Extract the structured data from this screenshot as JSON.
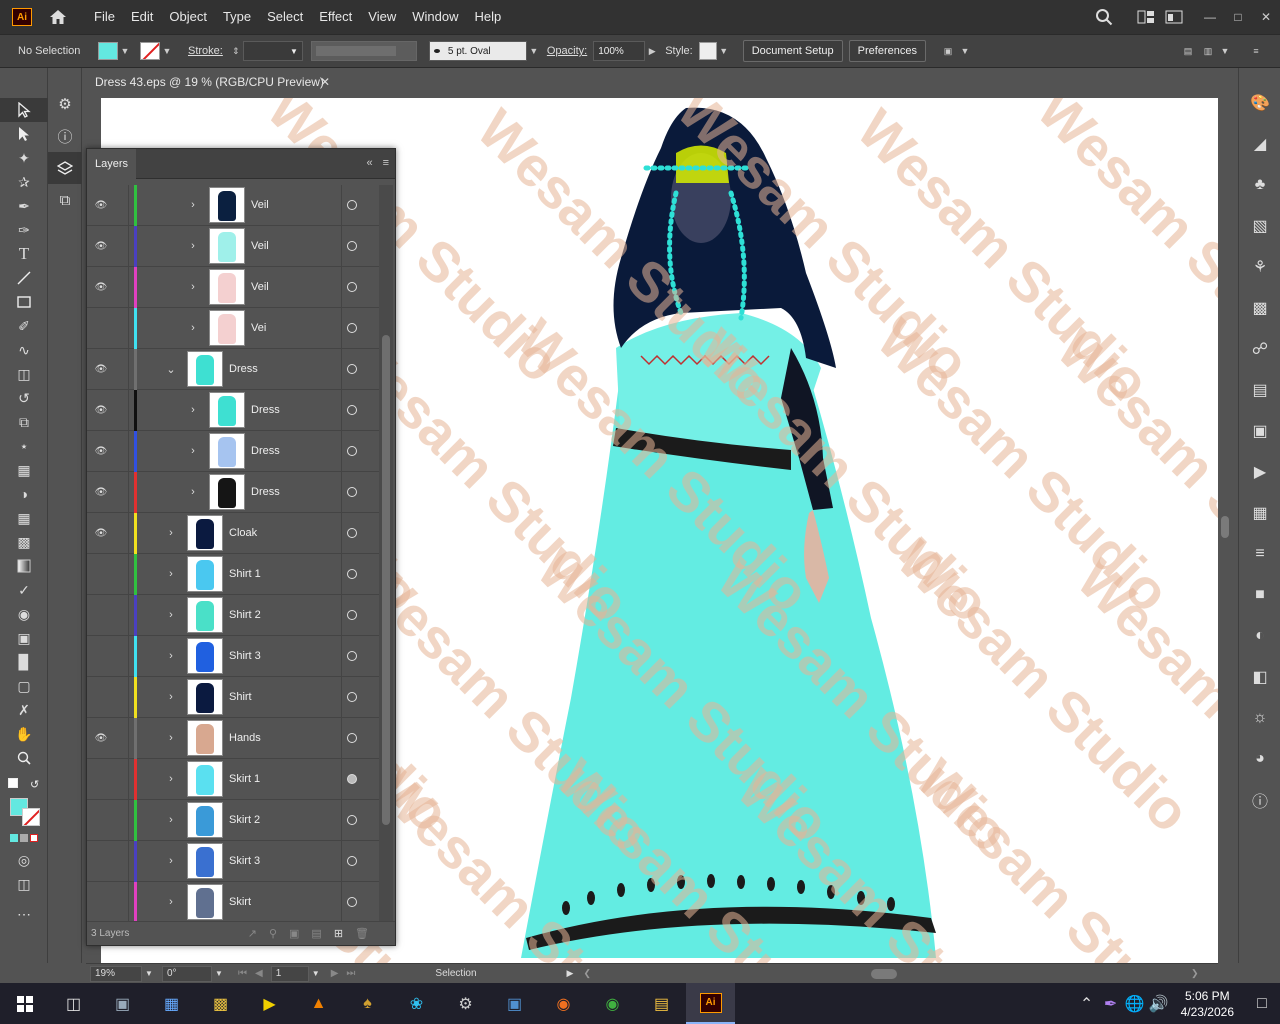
{
  "app": {
    "logo": "Ai",
    "menu": [
      "File",
      "Edit",
      "Object",
      "Type",
      "Select",
      "Effect",
      "View",
      "Window",
      "Help"
    ]
  },
  "control": {
    "selection": "No Selection",
    "stroke_label": "Stroke:",
    "brush": "5 pt. Oval",
    "opacity_label": "Opacity:",
    "opacity_value": "100%",
    "style_label": "Style:",
    "document_setup": "Document Setup",
    "preferences": "Preferences"
  },
  "document": {
    "tab_title": "Dress 43.eps @ 19 % (RGB/CPU Preview)",
    "watermark": "Wesam Studio"
  },
  "layers_panel": {
    "title": "Layers",
    "count": "3 Layers",
    "rows": [
      {
        "name": "Veil",
        "visible": true,
        "color": "#30c040",
        "indent": 2,
        "expanded": false,
        "thumb": "#0b2040",
        "target_filled": false
      },
      {
        "name": "Veil",
        "visible": true,
        "color": "#4a40c0",
        "indent": 2,
        "expanded": false,
        "thumb": "#9ff0ea",
        "target_filled": false
      },
      {
        "name": "Veil",
        "visible": true,
        "color": "#e040c0",
        "indent": 2,
        "expanded": false,
        "thumb": "#f4d0d0",
        "target_filled": false
      },
      {
        "name": "Vei",
        "visible": false,
        "color": "#40e0f0",
        "indent": 2,
        "expanded": false,
        "thumb": "#f4d0d0",
        "target_filled": false
      },
      {
        "name": "Dress",
        "visible": true,
        "color": "#707070",
        "indent": 1,
        "expanded": true,
        "thumb": "#3ee0d2",
        "target_filled": false
      },
      {
        "name": "Dress",
        "visible": true,
        "color": "#101010",
        "indent": 2,
        "expanded": false,
        "thumb": "#3ee0d2",
        "target_filled": false
      },
      {
        "name": "Dress",
        "visible": true,
        "color": "#3050e0",
        "indent": 2,
        "expanded": false,
        "thumb": "#a6c4f0",
        "target_filled": false
      },
      {
        "name": "Dress",
        "visible": true,
        "color": "#e03030",
        "indent": 2,
        "expanded": false,
        "thumb": "#151515",
        "target_filled": false
      },
      {
        "name": "Cloak",
        "visible": true,
        "color": "#f0e020",
        "indent": 1,
        "expanded": false,
        "thumb": "#0b1a40",
        "target_filled": false
      },
      {
        "name": "Shirt 1",
        "visible": false,
        "color": "#30c040",
        "indent": 1,
        "expanded": false,
        "thumb": "#4ac8f0",
        "target_filled": false
      },
      {
        "name": "Shirt 2",
        "visible": false,
        "color": "#4a40c0",
        "indent": 1,
        "expanded": false,
        "thumb": "#4ae0c8",
        "target_filled": false
      },
      {
        "name": "Shirt 3",
        "visible": false,
        "color": "#40e0f0",
        "indent": 1,
        "expanded": false,
        "thumb": "#2060e0",
        "target_filled": false
      },
      {
        "name": "Shirt",
        "visible": false,
        "color": "#f0e020",
        "indent": 1,
        "expanded": false,
        "thumb": "#0b1a40",
        "target_filled": false
      },
      {
        "name": "Hands",
        "visible": true,
        "color": "#707070",
        "indent": 1,
        "expanded": false,
        "thumb": "#d8a890",
        "target_filled": false
      },
      {
        "name": "Skirt 1",
        "visible": false,
        "color": "#e03030",
        "indent": 1,
        "expanded": false,
        "thumb": "#5ae0f0",
        "target_filled": true
      },
      {
        "name": "Skirt 2",
        "visible": false,
        "color": "#30c040",
        "indent": 1,
        "expanded": false,
        "thumb": "#3a9ad8",
        "target_filled": false
      },
      {
        "name": "Skirt 3",
        "visible": false,
        "color": "#4a40c0",
        "indent": 1,
        "expanded": false,
        "thumb": "#3a70d0",
        "target_filled": false
      },
      {
        "name": "Skirt",
        "visible": false,
        "color": "#e040c0",
        "indent": 1,
        "expanded": false,
        "thumb": "#607090",
        "target_filled": false
      }
    ]
  },
  "status": {
    "zoom": "19%",
    "rotate": "0°",
    "artboard": "1",
    "tool": "Selection"
  },
  "taskbar": {
    "time": "5:06 PM",
    "date": "4/23/2026"
  },
  "colors": {
    "fill": "#63e8e0",
    "dress": "#63ece2",
    "hair": "#0a1a3a"
  }
}
